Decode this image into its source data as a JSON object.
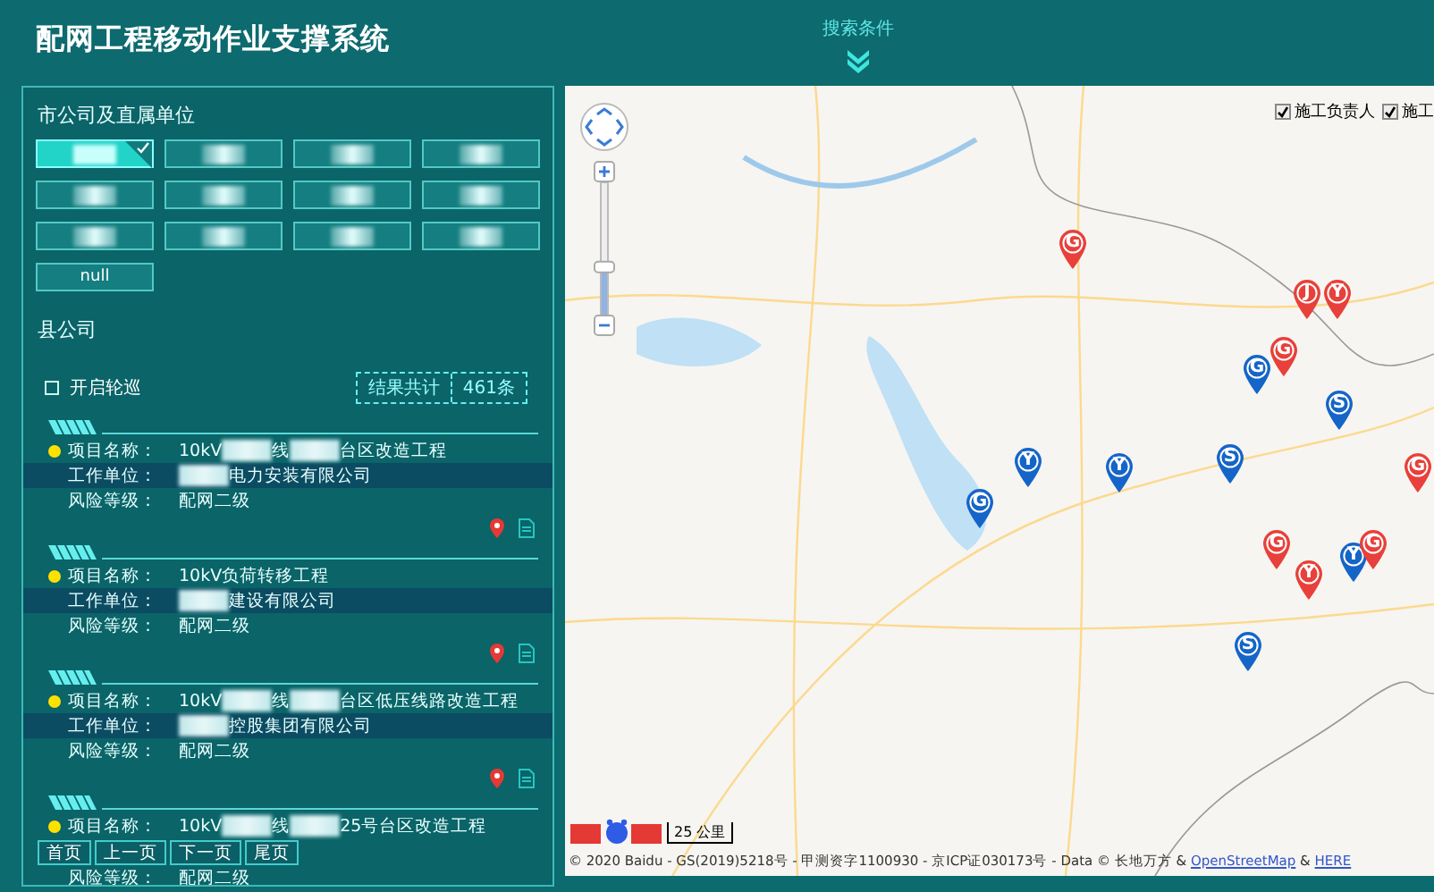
{
  "header": {
    "title": "配网工程移动作业支撑系统",
    "search_toggle": "搜索条件"
  },
  "side": {
    "city_label": "市公司及直属单位",
    "cities": [
      {
        "redacted": true,
        "selected": true
      },
      {
        "redacted": true,
        "selected": false
      },
      {
        "redacted": true,
        "selected": false
      },
      {
        "redacted": true,
        "selected": false
      },
      {
        "redacted": true,
        "selected": false
      },
      {
        "redacted": true,
        "selected": false
      },
      {
        "redacted": true,
        "selected": false
      },
      {
        "redacted": true,
        "selected": false
      },
      {
        "redacted": true,
        "selected": false
      },
      {
        "redacted": true,
        "selected": false
      },
      {
        "redacted": true,
        "selected": false
      },
      {
        "redacted": true,
        "selected": false
      },
      {
        "label": "null",
        "redacted": false,
        "selected": false
      }
    ],
    "county_label": "县公司",
    "patrol": {
      "label": "开启轮巡",
      "checked": false
    },
    "result": {
      "label": "结果共计",
      "count": "461条"
    },
    "projects": [
      {
        "fields": [
          {
            "label": "项目名称：",
            "segments": [
              {
                "kind": "text",
                "text": "10kV"
              },
              {
                "kind": "redacted"
              },
              {
                "kind": "text",
                "text": "线"
              },
              {
                "kind": "redacted"
              },
              {
                "kind": "text",
                "text": "台区改造工程"
              }
            ]
          },
          {
            "label": "工作单位：",
            "segments": [
              {
                "kind": "redacted"
              },
              {
                "kind": "text",
                "text": "电力安装有限公司"
              }
            ]
          },
          {
            "label": "风险等级：",
            "segments": [
              {
                "kind": "text",
                "text": "配网二级"
              }
            ]
          }
        ]
      },
      {
        "fields": [
          {
            "label": "项目名称：",
            "segments": [
              {
                "kind": "text",
                "text": "10kV负荷转移工程"
              }
            ]
          },
          {
            "label": "工作单位：",
            "segments": [
              {
                "kind": "redacted"
              },
              {
                "kind": "text",
                "text": "建设有限公司"
              }
            ]
          },
          {
            "label": "风险等级：",
            "segments": [
              {
                "kind": "text",
                "text": "配网二级"
              }
            ]
          }
        ]
      },
      {
        "fields": [
          {
            "label": "项目名称：",
            "segments": [
              {
                "kind": "text",
                "text": "10kV"
              },
              {
                "kind": "redacted"
              },
              {
                "kind": "text",
                "text": "线"
              },
              {
                "kind": "redacted"
              },
              {
                "kind": "text",
                "text": "台区低压线路改造工程"
              }
            ]
          },
          {
            "label": "工作单位：",
            "segments": [
              {
                "kind": "redacted"
              },
              {
                "kind": "text",
                "text": "控股集团有限公司"
              }
            ]
          },
          {
            "label": "风险等级：",
            "segments": [
              {
                "kind": "text",
                "text": "配网二级"
              }
            ]
          }
        ]
      },
      {
        "fields": [
          {
            "label": "项目名称：",
            "segments": [
              {
                "kind": "text",
                "text": "10kV"
              },
              {
                "kind": "redacted"
              },
              {
                "kind": "text",
                "text": "线"
              },
              {
                "kind": "redacted"
              },
              {
                "kind": "text",
                "text": "25号台区改造工程"
              }
            ]
          },
          {
            "label": "风险等级：",
            "segments": [
              {
                "kind": "text",
                "text": "配网二级"
              }
            ]
          }
        ]
      }
    ],
    "pager": [
      "首页",
      "上一页",
      "下一页",
      "尾页"
    ]
  },
  "map": {
    "layers": [
      {
        "label": "施工负责人",
        "checked": true
      },
      {
        "label": "施工",
        "checked": true
      }
    ],
    "zoom": {
      "level": 0.36
    },
    "pins": [
      {
        "letter": "G",
        "color": "#1565c8"
      },
      {
        "letter": "Y",
        "color": "#1565c8"
      },
      {
        "letter": "G",
        "color": "#e8403a"
      },
      {
        "letter": "Y",
        "color": "#1565c8"
      },
      {
        "letter": "S",
        "color": "#1565c8"
      },
      {
        "letter": "S",
        "color": "#1565c8"
      },
      {
        "letter": "G",
        "color": "#1565c8"
      },
      {
        "letter": "G",
        "color": "#e8403a"
      },
      {
        "letter": "G",
        "color": "#e8403a"
      },
      {
        "letter": "J",
        "color": "#e8403a"
      },
      {
        "letter": "Y",
        "color": "#e8403a"
      },
      {
        "letter": "Y",
        "color": "#e8403a"
      },
      {
        "letter": "S",
        "color": "#1565c8"
      },
      {
        "letter": "Y",
        "color": "#1565c8"
      },
      {
        "letter": "G",
        "color": "#e8403a"
      },
      {
        "letter": "G",
        "color": "#e8403a"
      }
    ],
    "scale": "25 公里",
    "copyright": [
      {
        "kind": "text",
        "text": "© 2020 Baidu - GS(2019)5218号 - 甲测资字1100930 - 京ICP证030173号 - Data © 长地万方 & "
      },
      {
        "kind": "link",
        "text": "OpenStreetMap"
      },
      {
        "kind": "text",
        "text": " & "
      },
      {
        "kind": "link",
        "text": "HERE"
      }
    ]
  }
}
